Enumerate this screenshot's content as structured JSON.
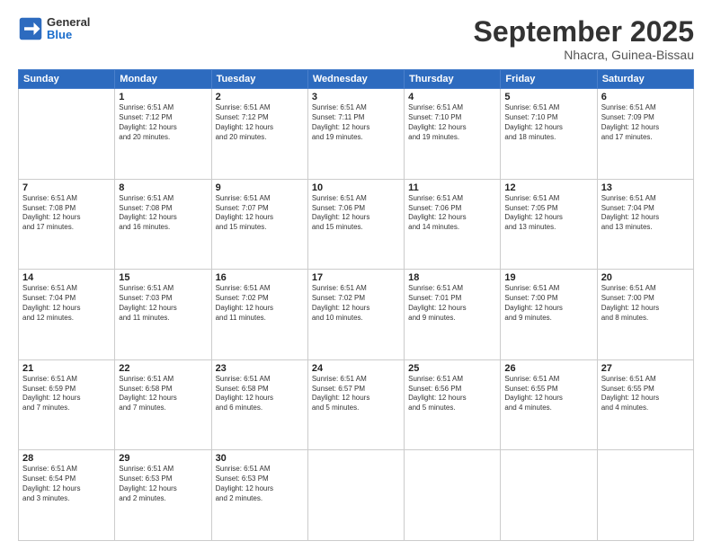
{
  "header": {
    "logo_line1": "General",
    "logo_line2": "Blue",
    "month": "September 2025",
    "location": "Nhacra, Guinea-Bissau"
  },
  "weekdays": [
    "Sunday",
    "Monday",
    "Tuesday",
    "Wednesday",
    "Thursday",
    "Friday",
    "Saturday"
  ],
  "weeks": [
    [
      {
        "day": "",
        "text": ""
      },
      {
        "day": "1",
        "text": "Sunrise: 6:51 AM\nSunset: 7:12 PM\nDaylight: 12 hours\nand 20 minutes."
      },
      {
        "day": "2",
        "text": "Sunrise: 6:51 AM\nSunset: 7:12 PM\nDaylight: 12 hours\nand 20 minutes."
      },
      {
        "day": "3",
        "text": "Sunrise: 6:51 AM\nSunset: 7:11 PM\nDaylight: 12 hours\nand 19 minutes."
      },
      {
        "day": "4",
        "text": "Sunrise: 6:51 AM\nSunset: 7:10 PM\nDaylight: 12 hours\nand 19 minutes."
      },
      {
        "day": "5",
        "text": "Sunrise: 6:51 AM\nSunset: 7:10 PM\nDaylight: 12 hours\nand 18 minutes."
      },
      {
        "day": "6",
        "text": "Sunrise: 6:51 AM\nSunset: 7:09 PM\nDaylight: 12 hours\nand 17 minutes."
      }
    ],
    [
      {
        "day": "7",
        "text": "Sunrise: 6:51 AM\nSunset: 7:08 PM\nDaylight: 12 hours\nand 17 minutes."
      },
      {
        "day": "8",
        "text": "Sunrise: 6:51 AM\nSunset: 7:08 PM\nDaylight: 12 hours\nand 16 minutes."
      },
      {
        "day": "9",
        "text": "Sunrise: 6:51 AM\nSunset: 7:07 PM\nDaylight: 12 hours\nand 15 minutes."
      },
      {
        "day": "10",
        "text": "Sunrise: 6:51 AM\nSunset: 7:06 PM\nDaylight: 12 hours\nand 15 minutes."
      },
      {
        "day": "11",
        "text": "Sunrise: 6:51 AM\nSunset: 7:06 PM\nDaylight: 12 hours\nand 14 minutes."
      },
      {
        "day": "12",
        "text": "Sunrise: 6:51 AM\nSunset: 7:05 PM\nDaylight: 12 hours\nand 13 minutes."
      },
      {
        "day": "13",
        "text": "Sunrise: 6:51 AM\nSunset: 7:04 PM\nDaylight: 12 hours\nand 13 minutes."
      }
    ],
    [
      {
        "day": "14",
        "text": "Sunrise: 6:51 AM\nSunset: 7:04 PM\nDaylight: 12 hours\nand 12 minutes."
      },
      {
        "day": "15",
        "text": "Sunrise: 6:51 AM\nSunset: 7:03 PM\nDaylight: 12 hours\nand 11 minutes."
      },
      {
        "day": "16",
        "text": "Sunrise: 6:51 AM\nSunset: 7:02 PM\nDaylight: 12 hours\nand 11 minutes."
      },
      {
        "day": "17",
        "text": "Sunrise: 6:51 AM\nSunset: 7:02 PM\nDaylight: 12 hours\nand 10 minutes."
      },
      {
        "day": "18",
        "text": "Sunrise: 6:51 AM\nSunset: 7:01 PM\nDaylight: 12 hours\nand 9 minutes."
      },
      {
        "day": "19",
        "text": "Sunrise: 6:51 AM\nSunset: 7:00 PM\nDaylight: 12 hours\nand 9 minutes."
      },
      {
        "day": "20",
        "text": "Sunrise: 6:51 AM\nSunset: 7:00 PM\nDaylight: 12 hours\nand 8 minutes."
      }
    ],
    [
      {
        "day": "21",
        "text": "Sunrise: 6:51 AM\nSunset: 6:59 PM\nDaylight: 12 hours\nand 7 minutes."
      },
      {
        "day": "22",
        "text": "Sunrise: 6:51 AM\nSunset: 6:58 PM\nDaylight: 12 hours\nand 7 minutes."
      },
      {
        "day": "23",
        "text": "Sunrise: 6:51 AM\nSunset: 6:58 PM\nDaylight: 12 hours\nand 6 minutes."
      },
      {
        "day": "24",
        "text": "Sunrise: 6:51 AM\nSunset: 6:57 PM\nDaylight: 12 hours\nand 5 minutes."
      },
      {
        "day": "25",
        "text": "Sunrise: 6:51 AM\nSunset: 6:56 PM\nDaylight: 12 hours\nand 5 minutes."
      },
      {
        "day": "26",
        "text": "Sunrise: 6:51 AM\nSunset: 6:55 PM\nDaylight: 12 hours\nand 4 minutes."
      },
      {
        "day": "27",
        "text": "Sunrise: 6:51 AM\nSunset: 6:55 PM\nDaylight: 12 hours\nand 4 minutes."
      }
    ],
    [
      {
        "day": "28",
        "text": "Sunrise: 6:51 AM\nSunset: 6:54 PM\nDaylight: 12 hours\nand 3 minutes."
      },
      {
        "day": "29",
        "text": "Sunrise: 6:51 AM\nSunset: 6:53 PM\nDaylight: 12 hours\nand 2 minutes."
      },
      {
        "day": "30",
        "text": "Sunrise: 6:51 AM\nSunset: 6:53 PM\nDaylight: 12 hours\nand 2 minutes."
      },
      {
        "day": "",
        "text": ""
      },
      {
        "day": "",
        "text": ""
      },
      {
        "day": "",
        "text": ""
      },
      {
        "day": "",
        "text": ""
      }
    ]
  ]
}
